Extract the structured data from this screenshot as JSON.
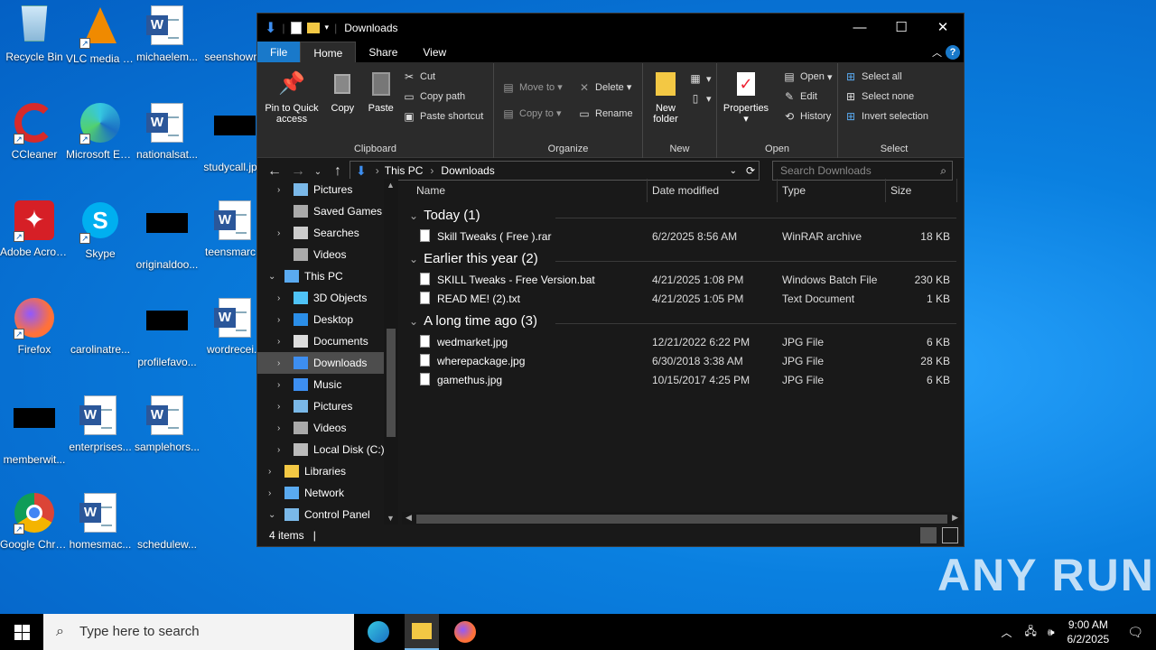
{
  "desktop": {
    "icons": [
      {
        "label": "Recycle Bin",
        "icon": "recycle-bin-icon"
      },
      {
        "label": "VLC media player",
        "icon": "vlc-icon"
      },
      {
        "label": "michaelem...",
        "icon": "word-doc-icon"
      },
      {
        "label": "seenshowr...",
        "icon": "blank-file-icon"
      },
      {
        "label": "CCleaner",
        "icon": "ccleaner-icon"
      },
      {
        "label": "Microsoft Edge",
        "icon": "edge-icon"
      },
      {
        "label": "nationalsat...",
        "icon": "word-doc-icon"
      },
      {
        "label": "studycall.jp...",
        "icon": "black-image-icon"
      },
      {
        "label": "Adobe Acrobat",
        "icon": "acrobat-icon"
      },
      {
        "label": "Skype",
        "icon": "skype-icon"
      },
      {
        "label": "originaldoo...",
        "icon": "black-image-icon"
      },
      {
        "label": "teensmarc...",
        "icon": "word-doc-icon"
      },
      {
        "label": "Firefox",
        "icon": "firefox-icon"
      },
      {
        "label": "carolinatre...",
        "icon": "blank-file-icon"
      },
      {
        "label": "profilefavo...",
        "icon": "black-image-icon"
      },
      {
        "label": "wordrecei...",
        "icon": "word-doc-icon"
      },
      {
        "label": "memberwit...",
        "icon": "black-image-icon"
      },
      {
        "label": "enterprises...",
        "icon": "word-doc-icon"
      },
      {
        "label": "samplehors...",
        "icon": "word-doc-icon"
      },
      {
        "label": "Google Chrome",
        "icon": "chrome-icon"
      },
      {
        "label": "homesmac...",
        "icon": "word-doc-icon"
      },
      {
        "label": "schedulew...",
        "icon": "blank-file-icon"
      }
    ],
    "watermark": "ANY RUN"
  },
  "window": {
    "title": "Downloads",
    "controls": {
      "minimize": "—",
      "maximize": "☐",
      "close": "✕"
    },
    "tabs": [
      "File",
      "Home",
      "Share",
      "View"
    ],
    "active_tab": "Home",
    "help": "?",
    "ribbon": {
      "clipboard": {
        "label": "Clipboard",
        "pin": "Pin to Quick access",
        "copy": "Copy",
        "paste": "Paste",
        "cut": "Cut",
        "copy_path": "Copy path",
        "paste_shortcut": "Paste shortcut"
      },
      "organize": {
        "label": "Organize",
        "move_to": "Move to",
        "copy_to": "Copy to",
        "delete": "Delete",
        "rename": "Rename"
      },
      "new": {
        "label": "New",
        "new_folder": "New folder"
      },
      "open": {
        "label": "Open",
        "properties": "Properties",
        "open": "Open",
        "edit": "Edit",
        "history": "History"
      },
      "select": {
        "label": "Select",
        "select_all": "Select all",
        "select_none": "Select none",
        "invert": "Invert selection"
      }
    },
    "address": {
      "parts": [
        "This PC",
        "Downloads"
      ],
      "search_placeholder": "Search Downloads"
    },
    "nav": [
      {
        "label": "Pictures",
        "indent": 1,
        "chevron": "›",
        "icon": "pictures-icon"
      },
      {
        "label": "Saved Games",
        "indent": 1,
        "chevron": "",
        "icon": "saved-games-icon"
      },
      {
        "label": "Searches",
        "indent": 1,
        "chevron": "›",
        "icon": "searches-icon"
      },
      {
        "label": "Videos",
        "indent": 1,
        "chevron": "",
        "icon": "videos-icon"
      },
      {
        "label": "This PC",
        "indent": 0,
        "chevron": "⌄",
        "icon": "this-pc-icon"
      },
      {
        "label": "3D Objects",
        "indent": 1,
        "chevron": "›",
        "icon": "3d-objects-icon"
      },
      {
        "label": "Desktop",
        "indent": 1,
        "chevron": "›",
        "icon": "desktop-icon"
      },
      {
        "label": "Documents",
        "indent": 1,
        "chevron": "›",
        "icon": "documents-icon"
      },
      {
        "label": "Downloads",
        "indent": 1,
        "chevron": "›",
        "icon": "downloads-icon",
        "selected": true
      },
      {
        "label": "Music",
        "indent": 1,
        "chevron": "›",
        "icon": "music-icon"
      },
      {
        "label": "Pictures",
        "indent": 1,
        "chevron": "›",
        "icon": "pictures-icon"
      },
      {
        "label": "Videos",
        "indent": 1,
        "chevron": "›",
        "icon": "videos-icon"
      },
      {
        "label": "Local Disk (C:)",
        "indent": 1,
        "chevron": "›",
        "icon": "drive-icon"
      },
      {
        "label": "Libraries",
        "indent": 0,
        "chevron": "›",
        "icon": "libraries-icon"
      },
      {
        "label": "Network",
        "indent": 0,
        "chevron": "›",
        "icon": "network-icon"
      },
      {
        "label": "Control Panel",
        "indent": 0,
        "chevron": "⌄",
        "icon": "control-panel-icon"
      }
    ],
    "columns": {
      "name": "Name",
      "date": "Date modified",
      "type": "Type",
      "size": "Size"
    },
    "groups": [
      {
        "title": "Today (1)",
        "files": [
          {
            "name": "Skill Tweaks ( Free ).rar",
            "date": "6/2/2025 8:56 AM",
            "type": "WinRAR archive",
            "size": "18 KB"
          }
        ]
      },
      {
        "title": "Earlier this year (2)",
        "files": [
          {
            "name": "SKILL Tweaks - Free Version.bat",
            "date": "4/21/2025 1:08 PM",
            "type": "Windows Batch File",
            "size": "230 KB"
          },
          {
            "name": "READ ME! (2).txt",
            "date": "4/21/2025 1:05 PM",
            "type": "Text Document",
            "size": "1 KB"
          }
        ]
      },
      {
        "title": "A long time ago (3)",
        "files": [
          {
            "name": "wedmarket.jpg",
            "date": "12/21/2022 6:22 PM",
            "type": "JPG File",
            "size": "6 KB"
          },
          {
            "name": "wherepackage.jpg",
            "date": "6/30/2018 3:38 AM",
            "type": "JPG File",
            "size": "28 KB"
          },
          {
            "name": "gamethus.jpg",
            "date": "10/15/2017 4:25 PM",
            "type": "JPG File",
            "size": "6 KB"
          }
        ]
      }
    ],
    "status": "4 items"
  },
  "taskbar": {
    "search_placeholder": "Type here to search",
    "time": "9:00 AM",
    "date": "6/2/2025"
  },
  "colors": {
    "accent": "#1979ca",
    "explorer_bg": "#191919",
    "ribbon_bg": "#2b2b2b",
    "selected": "#4d4d4d"
  }
}
